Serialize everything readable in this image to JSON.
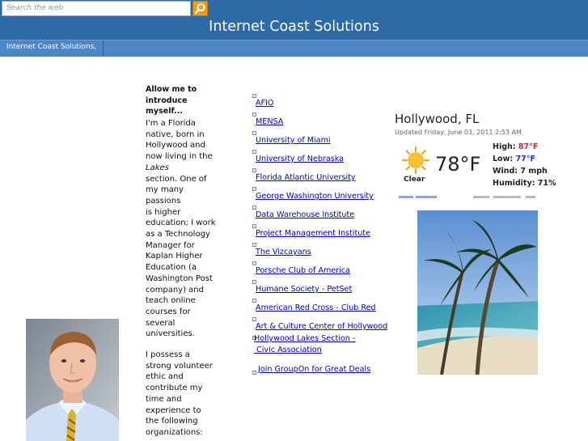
{
  "search": {
    "placeholder": "Search the web"
  },
  "header": {
    "title": "Internet Coast Solutions"
  },
  "nav": {
    "items": [
      {
        "label": "Internet Coast Solutions,"
      }
    ]
  },
  "intro": {
    "heading_line1": "Allow me to",
    "heading_line2": "introduce myself...",
    "p1_lines": [
      "I'm a Florida",
      "native, born in",
      "Hollywood and",
      "now living in the",
      "Lakes",
      "section. One of",
      "my many",
      "passions",
      "is higher",
      "education; I work",
      "as a Technology",
      "Manager for",
      "Kaplan Higher",
      "Education (a",
      "Washington Post",
      "company) and",
      "teach online",
      "courses for",
      "several",
      "universities."
    ],
    "p2_lines": [
      "I possess a",
      "strong volunteer",
      "ethic and",
      "contribute my",
      "time and",
      "experience to",
      "the following",
      "organizations:"
    ]
  },
  "links": [
    {
      "label": "AFIO"
    },
    {
      "label": "MENSA"
    },
    {
      "label": "University of Miami"
    },
    {
      "label": "University of Nebraska"
    },
    {
      "label": "Florida Atlantic University"
    },
    {
      "label": "George Washington University"
    },
    {
      "label": "Data Warehouse Institute"
    },
    {
      "label": "Project Management Institute"
    },
    {
      "label": "The Vizcayans"
    },
    {
      "label": "Porsche Club of America"
    },
    {
      "label": "Humane Society - PetSet"
    },
    {
      "label": "American Red Cross - Club Red"
    },
    {
      "label": "Art & Culture Center of Hollywood"
    },
    {
      "label": "Hollywood Lakes Section -",
      "label2": " Civic Association"
    },
    {
      "label": "Join GroupOn for Great Deals"
    }
  ],
  "weather": {
    "city": "Hollywood, FL",
    "updated": "Updated Friday, June 03, 2011 2:53 AM",
    "condition": "Clear",
    "temp": "78°F",
    "high_label": "High: ",
    "high_value": "87°F",
    "low_label": "Low: ",
    "low_value": "77°F",
    "wind": "Wind: 7 mph",
    "humidity": "Humidity: 71%",
    "icon": "sun-icon",
    "colors": {
      "high": "#e02020",
      "low": "#2030e0"
    }
  },
  "colors": {
    "header": "#2e6aa6",
    "navbar": "#4f86c5",
    "search_button": "#f29a1b",
    "link": "#0000cc"
  }
}
